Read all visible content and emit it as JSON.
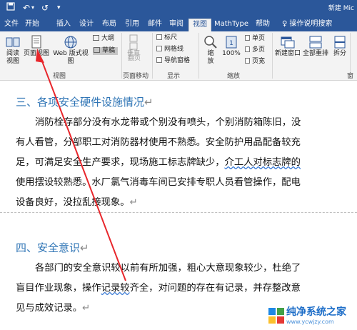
{
  "window": {
    "title": "新建 Mic"
  },
  "quick_access": {
    "undo_symbol": "↶",
    "redo_symbol": "↺",
    "more_symbol": "▾"
  },
  "tabs": [
    {
      "label": "文件",
      "active": false
    },
    {
      "label": "开始",
      "active": false
    },
    {
      "label": "插入",
      "active": false
    },
    {
      "label": "设计",
      "active": false
    },
    {
      "label": "布局",
      "active": false
    },
    {
      "label": "引用",
      "active": false
    },
    {
      "label": "邮件",
      "active": false
    },
    {
      "label": "审阅",
      "active": false
    },
    {
      "label": "视图",
      "active": true
    },
    {
      "label": "MathType",
      "active": false
    },
    {
      "label": "帮助",
      "active": false
    }
  ],
  "tell_me": "操作说明搜索",
  "ribbon": {
    "views": {
      "read_mode": "阅读\n视图",
      "print_layout": "页面视图",
      "web_layout": "Web 版式视图",
      "outline": "大纲",
      "draft": "草稿",
      "group_label": "视图"
    },
    "page_movement": {
      "vertical": "垂直",
      "side_to_side": "翻页",
      "group_label": "页面移动"
    },
    "show": {
      "ruler": "标尺",
      "gridlines": "网格线",
      "navigation": "导航窗格",
      "group_label": "显示"
    },
    "zoom": {
      "zoom": "缩\n放",
      "percent": "100%",
      "one_page": "单页",
      "multi_page": "多页",
      "page_width": "页宽",
      "group_label": "缩放"
    },
    "window": {
      "new_window": "新建窗口",
      "arrange_all": "全部重排",
      "split": "拆分",
      "group_label": "窗口"
    }
  },
  "document": {
    "heading3": "三、各项安全硬件设施情况",
    "para3": [
      "消防栓存部分没有水龙带或个别没有喷头，个别消防箱陈旧，没",
      "有人看管，分部职工对消防器材使用不熟悉。安全防护用品配备较充",
      "足，可满足安全生产要求，现场施工标志牌缺少，",
      "使用摆设较熟悉。水厂氯气消毒车间已安排专职人员看管操作，配电",
      "设备良好，没拉乱接现象。"
    ],
    "para3_line3_tail": "介工人对标志牌的",
    "heading4": "四、安全意识",
    "para4": [
      "各部门的安全意识较以前有所加强，粗心大意现象较少，杜绝了",
      "盲目作业现象，操作",
      "见与成效记录。"
    ],
    "para4_line2_underlined": "记录较",
    "para4_line2_tail": "齐全，对问题的存在有记录，并存整改意",
    "paragraph_mark": "↵"
  },
  "watermark": {
    "name": "纯净系统之家",
    "url": "www.ycwjzy.com"
  },
  "accent_color": "#2b579a",
  "annotation_color": "#e8262b"
}
